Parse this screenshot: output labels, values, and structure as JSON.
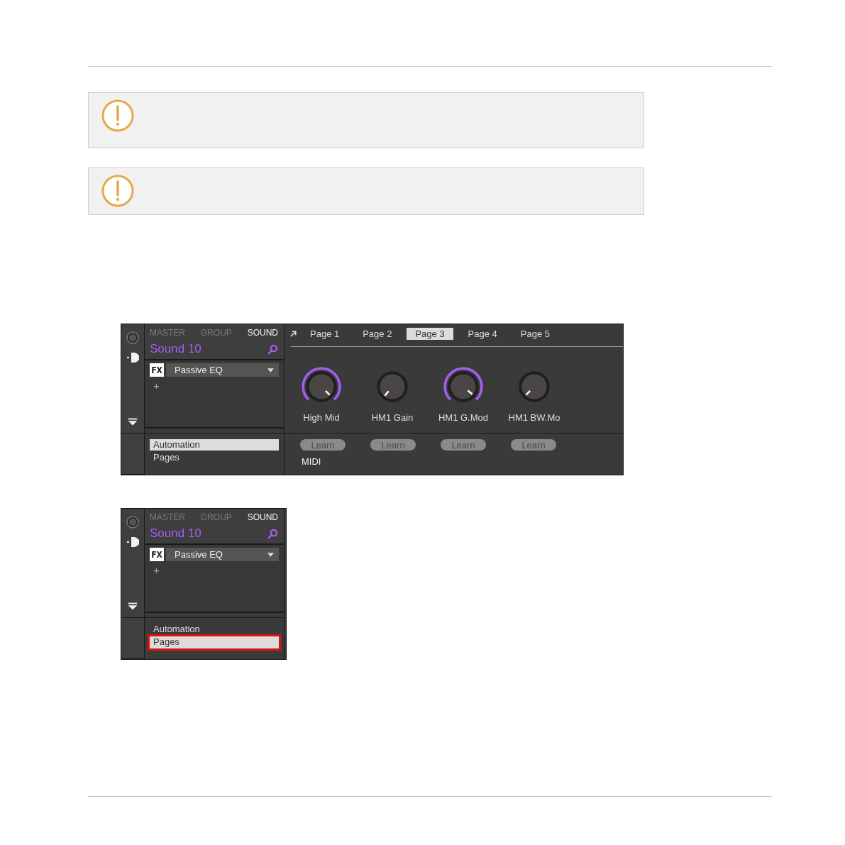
{
  "notes": [
    {
      "kind": "warning"
    },
    {
      "kind": "warning"
    }
  ],
  "panels": [
    {
      "kind": "full",
      "scope_tabs": [
        {
          "label": "MASTER",
          "selected": false
        },
        {
          "label": "GROUP",
          "selected": false
        },
        {
          "label": "SOUND",
          "selected": true
        }
      ],
      "sound_name": "Sound 10",
      "slot": {
        "badge": "FX",
        "name": "Passive EQ"
      },
      "add_label": "+",
      "sidebar_items": [
        {
          "label": "Automation",
          "selected": true,
          "outlined": false
        },
        {
          "label": "Pages",
          "selected": false,
          "outlined": false
        }
      ],
      "page_tabs": [
        {
          "label": "Page 1",
          "selected": false
        },
        {
          "label": "Page 2",
          "selected": false
        },
        {
          "label": "Page 3",
          "selected": true
        },
        {
          "label": "Page 4",
          "selected": false
        },
        {
          "label": "Page 5",
          "selected": false
        }
      ],
      "knobs": [
        {
          "label": "High Mid",
          "modulated": true
        },
        {
          "label": "HM1 Gain",
          "modulated": false
        },
        {
          "label": "HM1 G.Mod",
          "modulated": true
        },
        {
          "label": "HM1 BW.Mo",
          "modulated": false
        }
      ],
      "learn_buttons": [
        "Learn",
        "Learn",
        "Learn",
        "Learn"
      ],
      "section_label": "MIDI"
    },
    {
      "kind": "compact",
      "scope_tabs": [
        {
          "label": "MASTER",
          "selected": false
        },
        {
          "label": "GROUP",
          "selected": false
        },
        {
          "label": "SOUND",
          "selected": true
        }
      ],
      "sound_name": "Sound 10",
      "slot": {
        "badge": "FX",
        "name": "Passive EQ"
      },
      "add_label": "+",
      "sidebar_items": [
        {
          "label": "Automation",
          "selected": false,
          "outlined": false
        },
        {
          "label": "Pages",
          "selected": true,
          "outlined": true
        }
      ]
    }
  ]
}
